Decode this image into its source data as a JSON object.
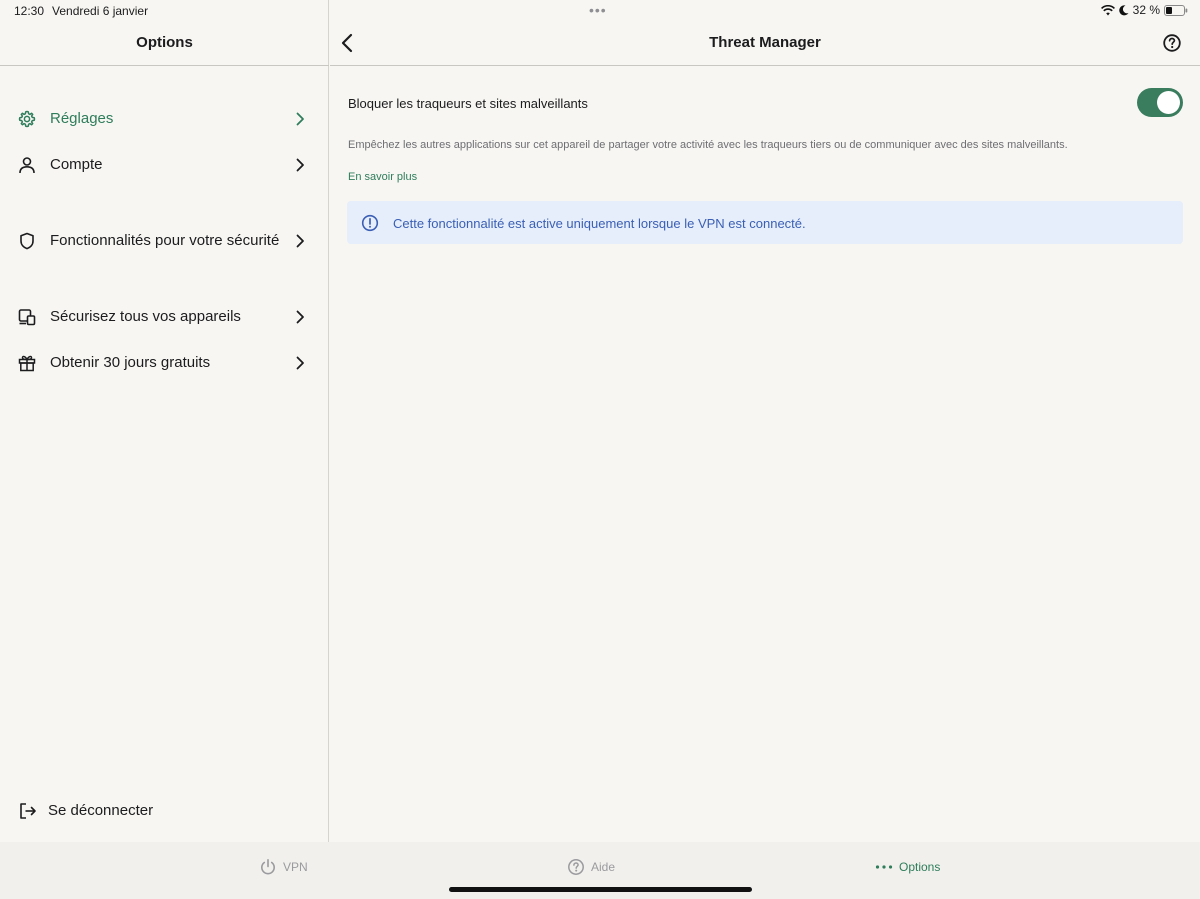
{
  "status_bar": {
    "time": "12:30",
    "date": "Vendredi 6 janvier",
    "battery": "32 %",
    "icons": [
      "wifi-icon",
      "moon-icon",
      "battery-icon"
    ]
  },
  "sidebar": {
    "title": "Options",
    "items": [
      {
        "label": "Réglages",
        "icon": "gear-icon",
        "active": true
      },
      {
        "label": "Compte",
        "icon": "person-icon"
      },
      {
        "label": "Fonctionnalités pour votre sécurité",
        "icon": "shield-icon"
      },
      {
        "label": "Sécurisez tous vos appareils",
        "icon": "devices-icon"
      },
      {
        "label": "Obtenir 30 jours gratuits",
        "icon": "gift-icon"
      }
    ],
    "logout_label": "Se déconnecter"
  },
  "main": {
    "title": "Threat Manager",
    "setting_label": "Bloquer les traqueurs et sites malveillants",
    "toggle_on": true,
    "description": "Empêchez les autres applications sur cet appareil de partager votre activité avec les traqueurs tiers ou de communiquer avec des sites malveillants.",
    "learn_more": "En savoir plus",
    "info_text": "Cette fonctionnalité est active uniquement lorsque le VPN est connecté."
  },
  "tabbar": {
    "tabs": [
      {
        "label": "VPN",
        "icon": "power-icon"
      },
      {
        "label": "Aide",
        "icon": "help-icon"
      },
      {
        "label": "Options",
        "icon": "more-icon",
        "active": true
      }
    ]
  },
  "colors": {
    "accent": "#2e7d5b",
    "toggle": "#3a7d5e",
    "info_bg": "#e5eefa",
    "info_text": "#3b5fb5",
    "background": "#f7f6f2"
  }
}
